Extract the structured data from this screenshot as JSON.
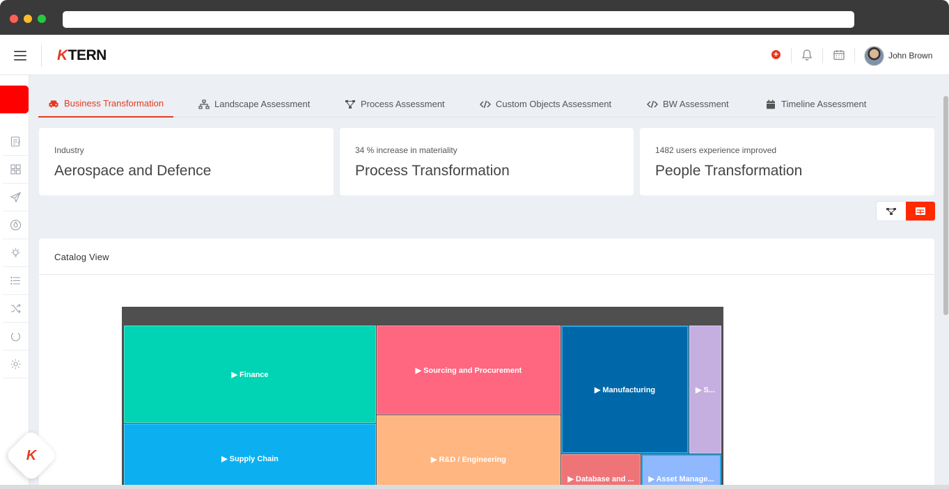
{
  "header": {
    "logo_text": "TERN",
    "logo_k": "K",
    "user_name": "John Brown",
    "accent_color": "#e53a1f"
  },
  "sidebar": {
    "items": [
      {
        "icon": "edit-icon"
      },
      {
        "icon": "grid-icon"
      },
      {
        "icon": "send-icon"
      },
      {
        "icon": "drop-icon"
      },
      {
        "icon": "bulb-icon"
      },
      {
        "icon": "list-icon"
      },
      {
        "icon": "shuffle-icon"
      },
      {
        "icon": "power-icon"
      },
      {
        "icon": "settings-icon"
      }
    ]
  },
  "tabs": [
    {
      "label": "Business Transformation",
      "icon": "car-icon",
      "active": true
    },
    {
      "label": "Landscape Assessment",
      "icon": "sitemap-icon",
      "active": false
    },
    {
      "label": "Process Assessment",
      "icon": "process-icon",
      "active": false
    },
    {
      "label": "Custom Objects Assessment",
      "icon": "code-icon",
      "active": false
    },
    {
      "label": "BW Assessment",
      "icon": "code-icon",
      "active": false
    },
    {
      "label": "Timeline Assessment",
      "icon": "calendar-icon",
      "active": false
    }
  ],
  "cards": [
    {
      "small": "Industry",
      "big": "Aerospace and Defence"
    },
    {
      "small": "34 % increase in materiality",
      "big": "Process Transformation"
    },
    {
      "small": "1482 users experience improved",
      "big": "People Transformation"
    }
  ],
  "catalog": {
    "title": "Catalog View"
  },
  "treemap": {
    "tiles": [
      {
        "label": "▶ Finance",
        "color": "#00d4b4"
      },
      {
        "label": "▶ Supply Chain",
        "color": "#0cb0f0"
      },
      {
        "label": "▶ Sourcing and Procurement",
        "color": "#ff6680"
      },
      {
        "label": "▶ R&D / Engineering",
        "color": "#ffb681"
      },
      {
        "label": "▶ Manufacturing",
        "color": "#0068a8"
      },
      {
        "label": "▶ S...",
        "color": "#c4afe0"
      },
      {
        "label": "▶ Database and ...",
        "color": "#ef7478"
      },
      {
        "label": "▶ Asset Manage...",
        "color": "#8fb8ff"
      }
    ]
  },
  "fab": {
    "label": "K"
  }
}
